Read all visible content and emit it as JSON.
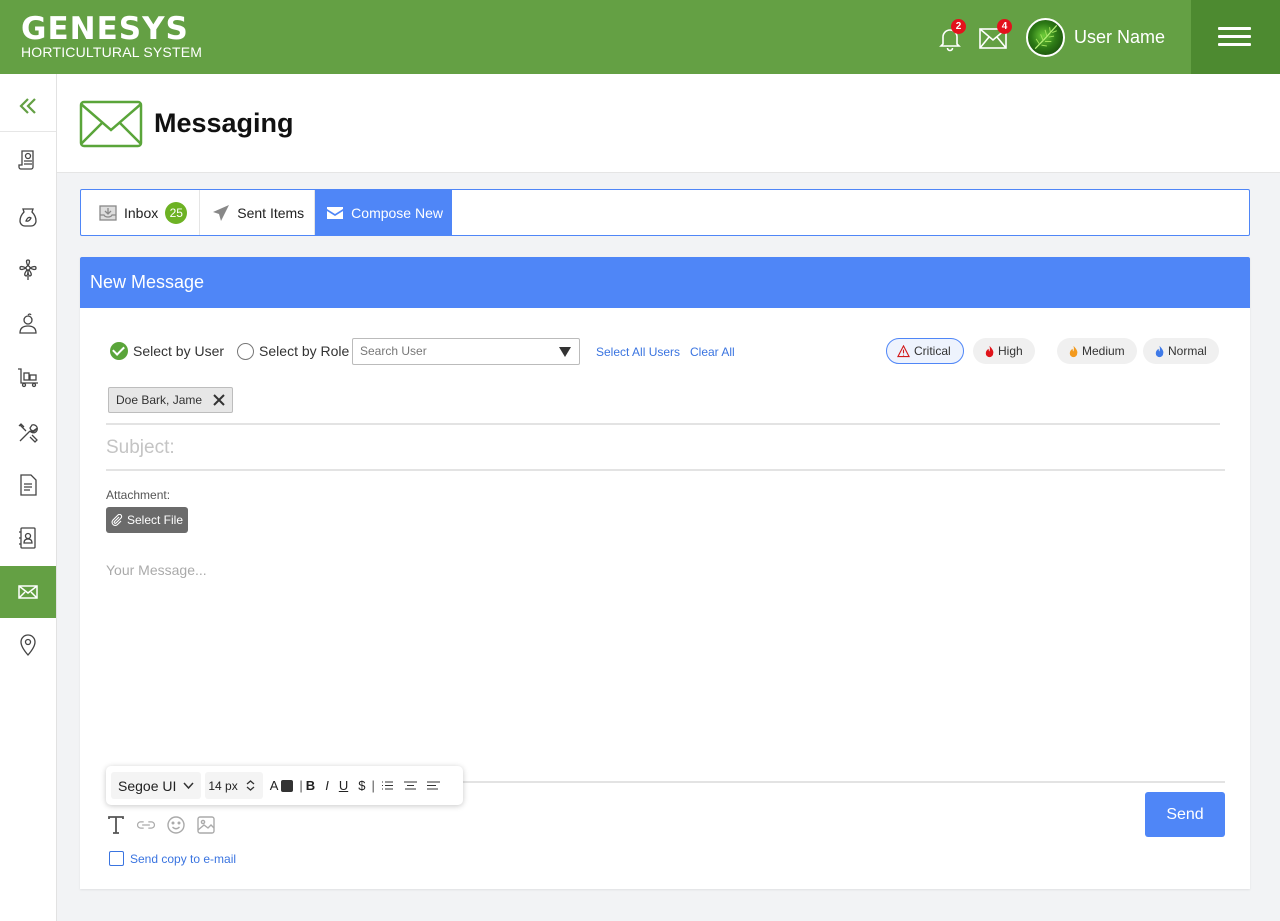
{
  "brand": {
    "name": "GENESYS",
    "subtitle": "HORTICULTURAL SYSTEM"
  },
  "topbar": {
    "notifications_count": "2",
    "messages_count": "4",
    "user_name": "User Name"
  },
  "colors": {
    "brand_green": "#64a044",
    "brand_green_dark": "#4d8a30",
    "accent_blue": "#4f86f7",
    "badge_red": "#e3121c"
  },
  "sidebar": {
    "items": [
      {
        "icon": "certificate-icon"
      },
      {
        "icon": "seed-bag-icon"
      },
      {
        "icon": "flower-icon"
      },
      {
        "icon": "user-plant-icon"
      },
      {
        "icon": "cart-icon"
      },
      {
        "icon": "tools-icon"
      },
      {
        "icon": "document-icon"
      },
      {
        "icon": "contact-book-icon"
      },
      {
        "icon": "envelope-icon",
        "active": true
      },
      {
        "icon": "location-pin-icon"
      }
    ]
  },
  "page": {
    "title": "Messaging"
  },
  "tabs": {
    "inbox_label": "Inbox",
    "inbox_count": "25",
    "sent_label": "Sent Items",
    "compose_label": "Compose New"
  },
  "compose": {
    "header": "New Message",
    "select_by_user": "Select by User",
    "select_by_role": "Select by Role",
    "search_placeholder": "Search User",
    "select_all": "Select All Users",
    "clear_all": "Clear All",
    "priorities": {
      "critical": "Critical",
      "high": "High",
      "medium": "Medium",
      "normal": "Normal"
    },
    "recipient": "Doe Bark, Jame",
    "subject_placeholder": "Subject:",
    "attachment_label": "Attachment:",
    "select_file": "Select File",
    "message_placeholder": "Your Message...",
    "send_label": "Send",
    "copy_label": "Send copy to e-mail"
  },
  "toolbar": {
    "font": "Segoe UI",
    "size": "14 px",
    "color_label": "A",
    "bold": "B",
    "italic": "I",
    "underline": "U",
    "strike": "$"
  }
}
